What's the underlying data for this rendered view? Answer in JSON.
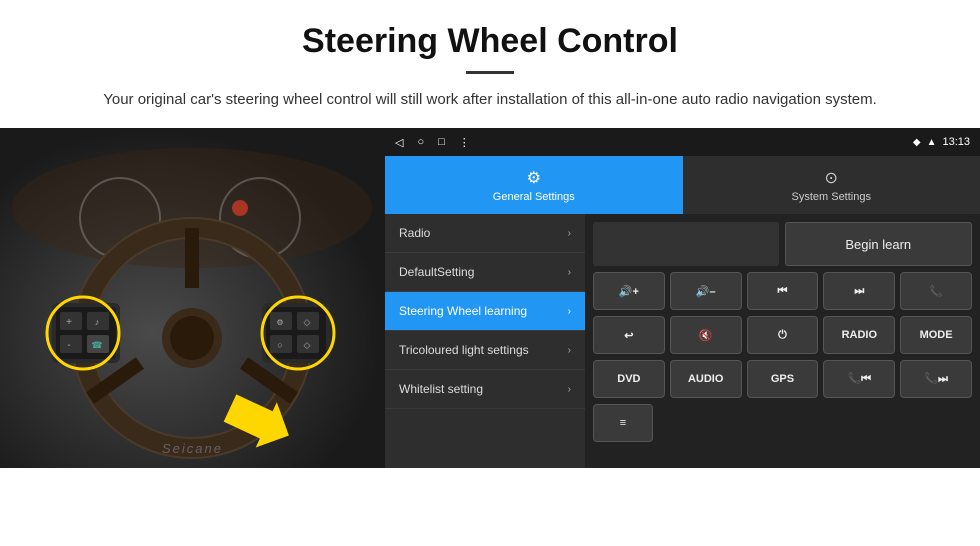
{
  "header": {
    "title": "Steering Wheel Control",
    "subtitle": "Your original car's steering wheel control will still work after installation of this all-in-one auto radio navigation system."
  },
  "status_bar": {
    "back_icon": "◁",
    "home_icon": "○",
    "recent_icon": "□",
    "menu_icon": "⋮",
    "gps_icon": "◆",
    "signal_icon": "▲",
    "time": "13:13"
  },
  "tabs": [
    {
      "label": "General Settings",
      "active": true
    },
    {
      "label": "System Settings",
      "active": false
    }
  ],
  "menu_items": [
    {
      "label": "Radio",
      "active": false
    },
    {
      "label": "DefaultSetting",
      "active": false
    },
    {
      "label": "Steering Wheel learning",
      "active": true
    },
    {
      "label": "Tricoloured light settings",
      "active": false
    },
    {
      "label": "Whitelist setting",
      "active": false
    }
  ],
  "right_panel": {
    "begin_learn_label": "Begin learn",
    "buttons_row1": [
      {
        "label": "🔊+",
        "type": "icon"
      },
      {
        "label": "🔊–",
        "type": "icon"
      },
      {
        "label": "⏮",
        "type": "icon"
      },
      {
        "label": "⏭",
        "type": "icon"
      },
      {
        "label": "📞",
        "type": "icon"
      }
    ],
    "buttons_row2": [
      {
        "label": "↩",
        "type": "icon"
      },
      {
        "label": "🔇",
        "type": "icon"
      },
      {
        "label": "⏻",
        "type": "icon"
      },
      {
        "label": "RADIO",
        "type": "text"
      },
      {
        "label": "MODE",
        "type": "text"
      }
    ],
    "buttons_row3": [
      {
        "label": "DVD",
        "type": "text"
      },
      {
        "label": "AUDIO",
        "type": "text"
      },
      {
        "label": "GPS",
        "type": "text"
      },
      {
        "label": "📞⏮",
        "type": "icon"
      },
      {
        "label": "📞⏭",
        "type": "icon"
      }
    ],
    "buttons_row4": [
      {
        "label": "≡",
        "type": "icon"
      }
    ]
  },
  "watermark": "Seicane"
}
